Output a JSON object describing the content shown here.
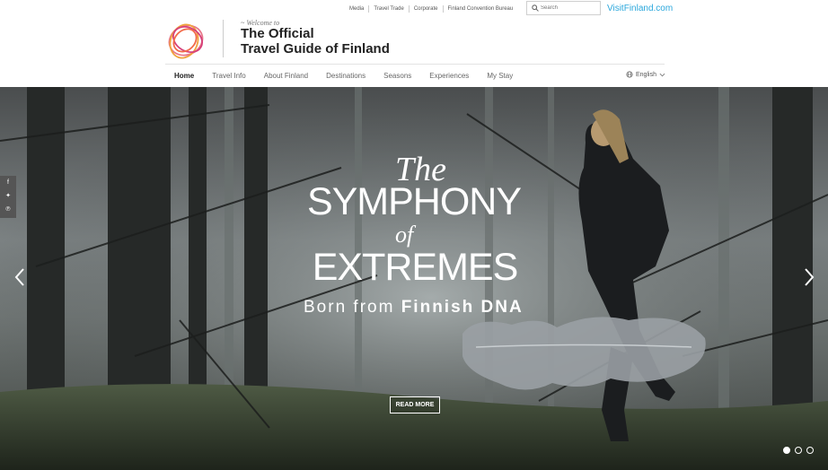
{
  "header": {
    "welcome": "~ Welcome to",
    "title_line1": "The Official",
    "title_line2": "Travel Guide of Finland",
    "utility_links": [
      "Media",
      "Travel Trade",
      "Corporate",
      "Finland Convention Bureau"
    ],
    "search_placeholder": "Search",
    "brand_link": "VisitFinland.com",
    "nav": [
      "Home",
      "Travel Info",
      "About Finland",
      "Destinations",
      "Seasons",
      "Experiences",
      "My Stay"
    ],
    "active_nav": "Home",
    "language": "English"
  },
  "social": {
    "icons": [
      "facebook-icon",
      "twitter-icon",
      "pinterest-icon"
    ]
  },
  "hero": {
    "the": "The",
    "symphony": "SYMPHONY",
    "of": "of",
    "extremes": "EXTREMES",
    "born_prefix": "Born from",
    "born_strong": "Finnish DNA",
    "read_more": "READ MORE",
    "slide_count": 3,
    "active_slide": 1
  },
  "colors": {
    "brand_blue": "#2aa7dc",
    "logo_ring": "#e8788a"
  }
}
